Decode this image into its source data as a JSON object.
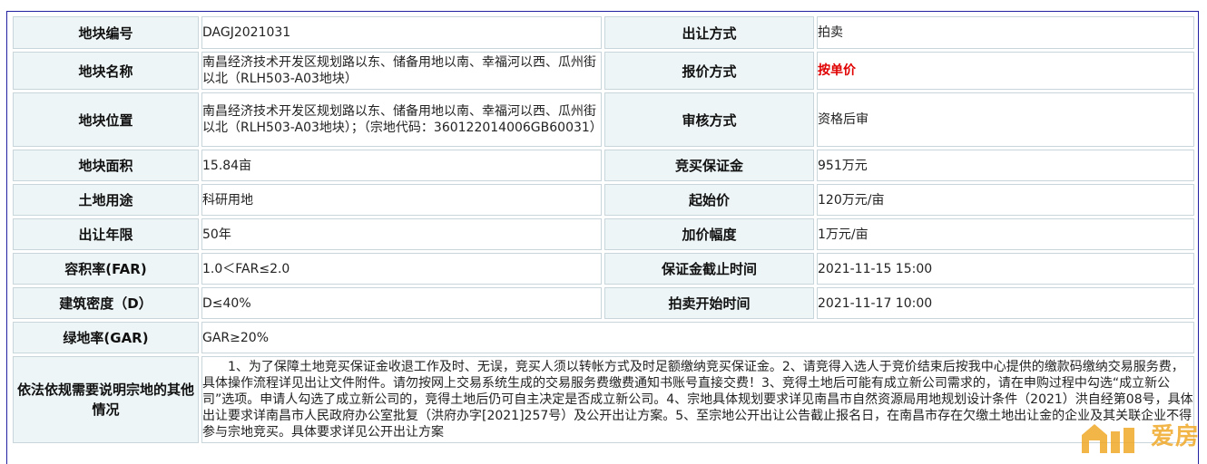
{
  "rows": [
    {
      "left_label": "地块编号",
      "left_value": "DAGJ2021031",
      "right_label": "出让方式",
      "right_value": "拍卖"
    },
    {
      "left_label": "地块名称",
      "left_value": "南昌经济技术开发区规划路以东、储备用地以南、幸福河以西、瓜州街以北（RLH503-A03地块）",
      "right_label": "报价方式",
      "right_value": "按单价"
    },
    {
      "left_label": "地块位置",
      "left_value": "南昌经济技术开发区规划路以东、储备用地以南、幸福河以西、瓜州街以北（RLH503-A03地块）；（宗地代码：360122014006GB60031）",
      "right_label": "审核方式",
      "right_value": "资格后审"
    },
    {
      "left_label": "地块面积",
      "left_value": "15.84亩",
      "right_label": "竞买保证金",
      "right_value": "951万元"
    },
    {
      "left_label": "土地用途",
      "left_value": "科研用地",
      "right_label": "起始价",
      "right_value": "120万元/亩"
    },
    {
      "left_label": "出让年限",
      "left_value": "50年",
      "right_label": "加价幅度",
      "right_value": "1万元/亩"
    },
    {
      "left_label": "容积率(FAR)",
      "left_value": "1.0＜FAR≤2.0",
      "right_label": "保证金截止时间",
      "right_value": "2021-11-15 15:00"
    },
    {
      "left_label": "建筑密度（D）",
      "left_value": "D≤40%",
      "right_label": "拍卖开始时间",
      "right_value": "2021-11-17 10:00"
    }
  ],
  "green_row": {
    "label": "绿地率(GAR)",
    "value": "GAR≥20%"
  },
  "notes_row": {
    "label": "依法依规需要说明宗地的其他情况",
    "value": "1、为了保障土地竞买保证金收退工作及时、无误，竞买人须以转帐方式及时足额缴纳竞买保证金。2、请竞得入选人于竞价结束后按我中心提供的缴款码缴纳交易服务费，具体操作流程详见出让文件附件。请勿按网上交易系统生成的交易服务费缴费通知书账号直接交费！3、竞得土地后可能有成立新公司需求的，请在申购过程中勾选“成立新公司”选项。申请人勾选了成立新公司的，竞得土地后仍可自主决定是否成立新公司。4、宗地具体规划要求详见南昌市自然资源局用地规划设计条件（2021）洪自经第08号，具体出让要求详南昌市人民政府办公室批复（洪府办字[2021]257号）及公开出让方案。5、至宗地公开出让公告截止报名日，在南昌市存在欠缴土地出让金的企业及其关联企业不得参与宗地竞买。具体要求详见公开出让方案"
  },
  "watermark": {
    "text": "爱房",
    "color": "#f0a828",
    "icon": "house-logo-icon"
  }
}
